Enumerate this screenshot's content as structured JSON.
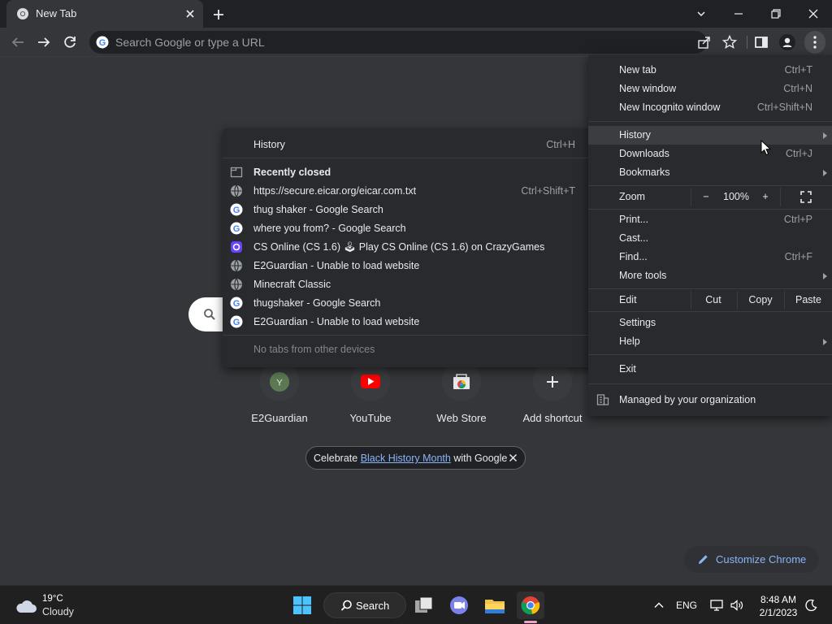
{
  "tab": {
    "title": "New Tab"
  },
  "omnibox": {
    "placeholder": "Search Google or type a URL"
  },
  "shortcuts": [
    {
      "label": "E2Guardian",
      "letter": "Y"
    },
    {
      "label": "YouTube"
    },
    {
      "label": "Web Store"
    },
    {
      "label": "Add shortcut"
    }
  ],
  "promo": {
    "prefix": "Celebrate ",
    "link": "Black History Month",
    "suffix": " with Google"
  },
  "customize": {
    "label": "Customize Chrome"
  },
  "history_menu": {
    "history": {
      "label": "History",
      "shortcut": "Ctrl+H"
    },
    "recently_closed": "Recently closed",
    "items": [
      {
        "label": "https://secure.eicar.org/eicar.com.txt",
        "shortcut": "Ctrl+Shift+T",
        "icon": "globe-icon"
      },
      {
        "label": "thug shaker - Google Search",
        "icon": "google-icon"
      },
      {
        "label": "where you from? - Google Search",
        "icon": "google-icon"
      },
      {
        "label": "CS Online (CS 1.6) 🕹 Play CS Online (CS 1.6) on CrazyGames",
        "icon": "crazygames-icon"
      },
      {
        "label": "E2Guardian - Unable to load website",
        "icon": "globe-icon"
      },
      {
        "label": "Minecraft Classic",
        "icon": "globe-icon"
      },
      {
        "label": "thugshaker - Google Search",
        "icon": "google-icon"
      },
      {
        "label": "E2Guardian - Unable to load website",
        "icon": "google-icon"
      }
    ],
    "other_devices": "No tabs from other devices"
  },
  "main_menu": {
    "new_tab": {
      "label": "New tab",
      "shortcut": "Ctrl+T"
    },
    "new_window": {
      "label": "New window",
      "shortcut": "Ctrl+N"
    },
    "new_incognito": {
      "label": "New Incognito window",
      "shortcut": "Ctrl+Shift+N"
    },
    "history": {
      "label": "History"
    },
    "downloads": {
      "label": "Downloads",
      "shortcut": "Ctrl+J"
    },
    "bookmarks": {
      "label": "Bookmarks"
    },
    "zoom": {
      "label": "Zoom",
      "minus": "−",
      "value": "100%",
      "plus": "+"
    },
    "print": {
      "label": "Print...",
      "shortcut": "Ctrl+P"
    },
    "cast": {
      "label": "Cast..."
    },
    "find": {
      "label": "Find...",
      "shortcut": "Ctrl+F"
    },
    "more_tools": {
      "label": "More tools"
    },
    "edit": {
      "label": "Edit",
      "cut": "Cut",
      "copy": "Copy",
      "paste": "Paste"
    },
    "settings": {
      "label": "Settings"
    },
    "help": {
      "label": "Help"
    },
    "exit": {
      "label": "Exit"
    },
    "managed": {
      "label": "Managed by your organization"
    }
  },
  "taskbar": {
    "weather": {
      "temp": "19°C",
      "condition": "Cloudy"
    },
    "search_label": "Search",
    "language": "ENG",
    "time": "8:48 AM",
    "date": "2/1/2023"
  },
  "colors": {
    "accent": "#8ab4f8",
    "menu_bg": "#292a2d",
    "page_bg": "#35363a",
    "frame": "#202124"
  }
}
